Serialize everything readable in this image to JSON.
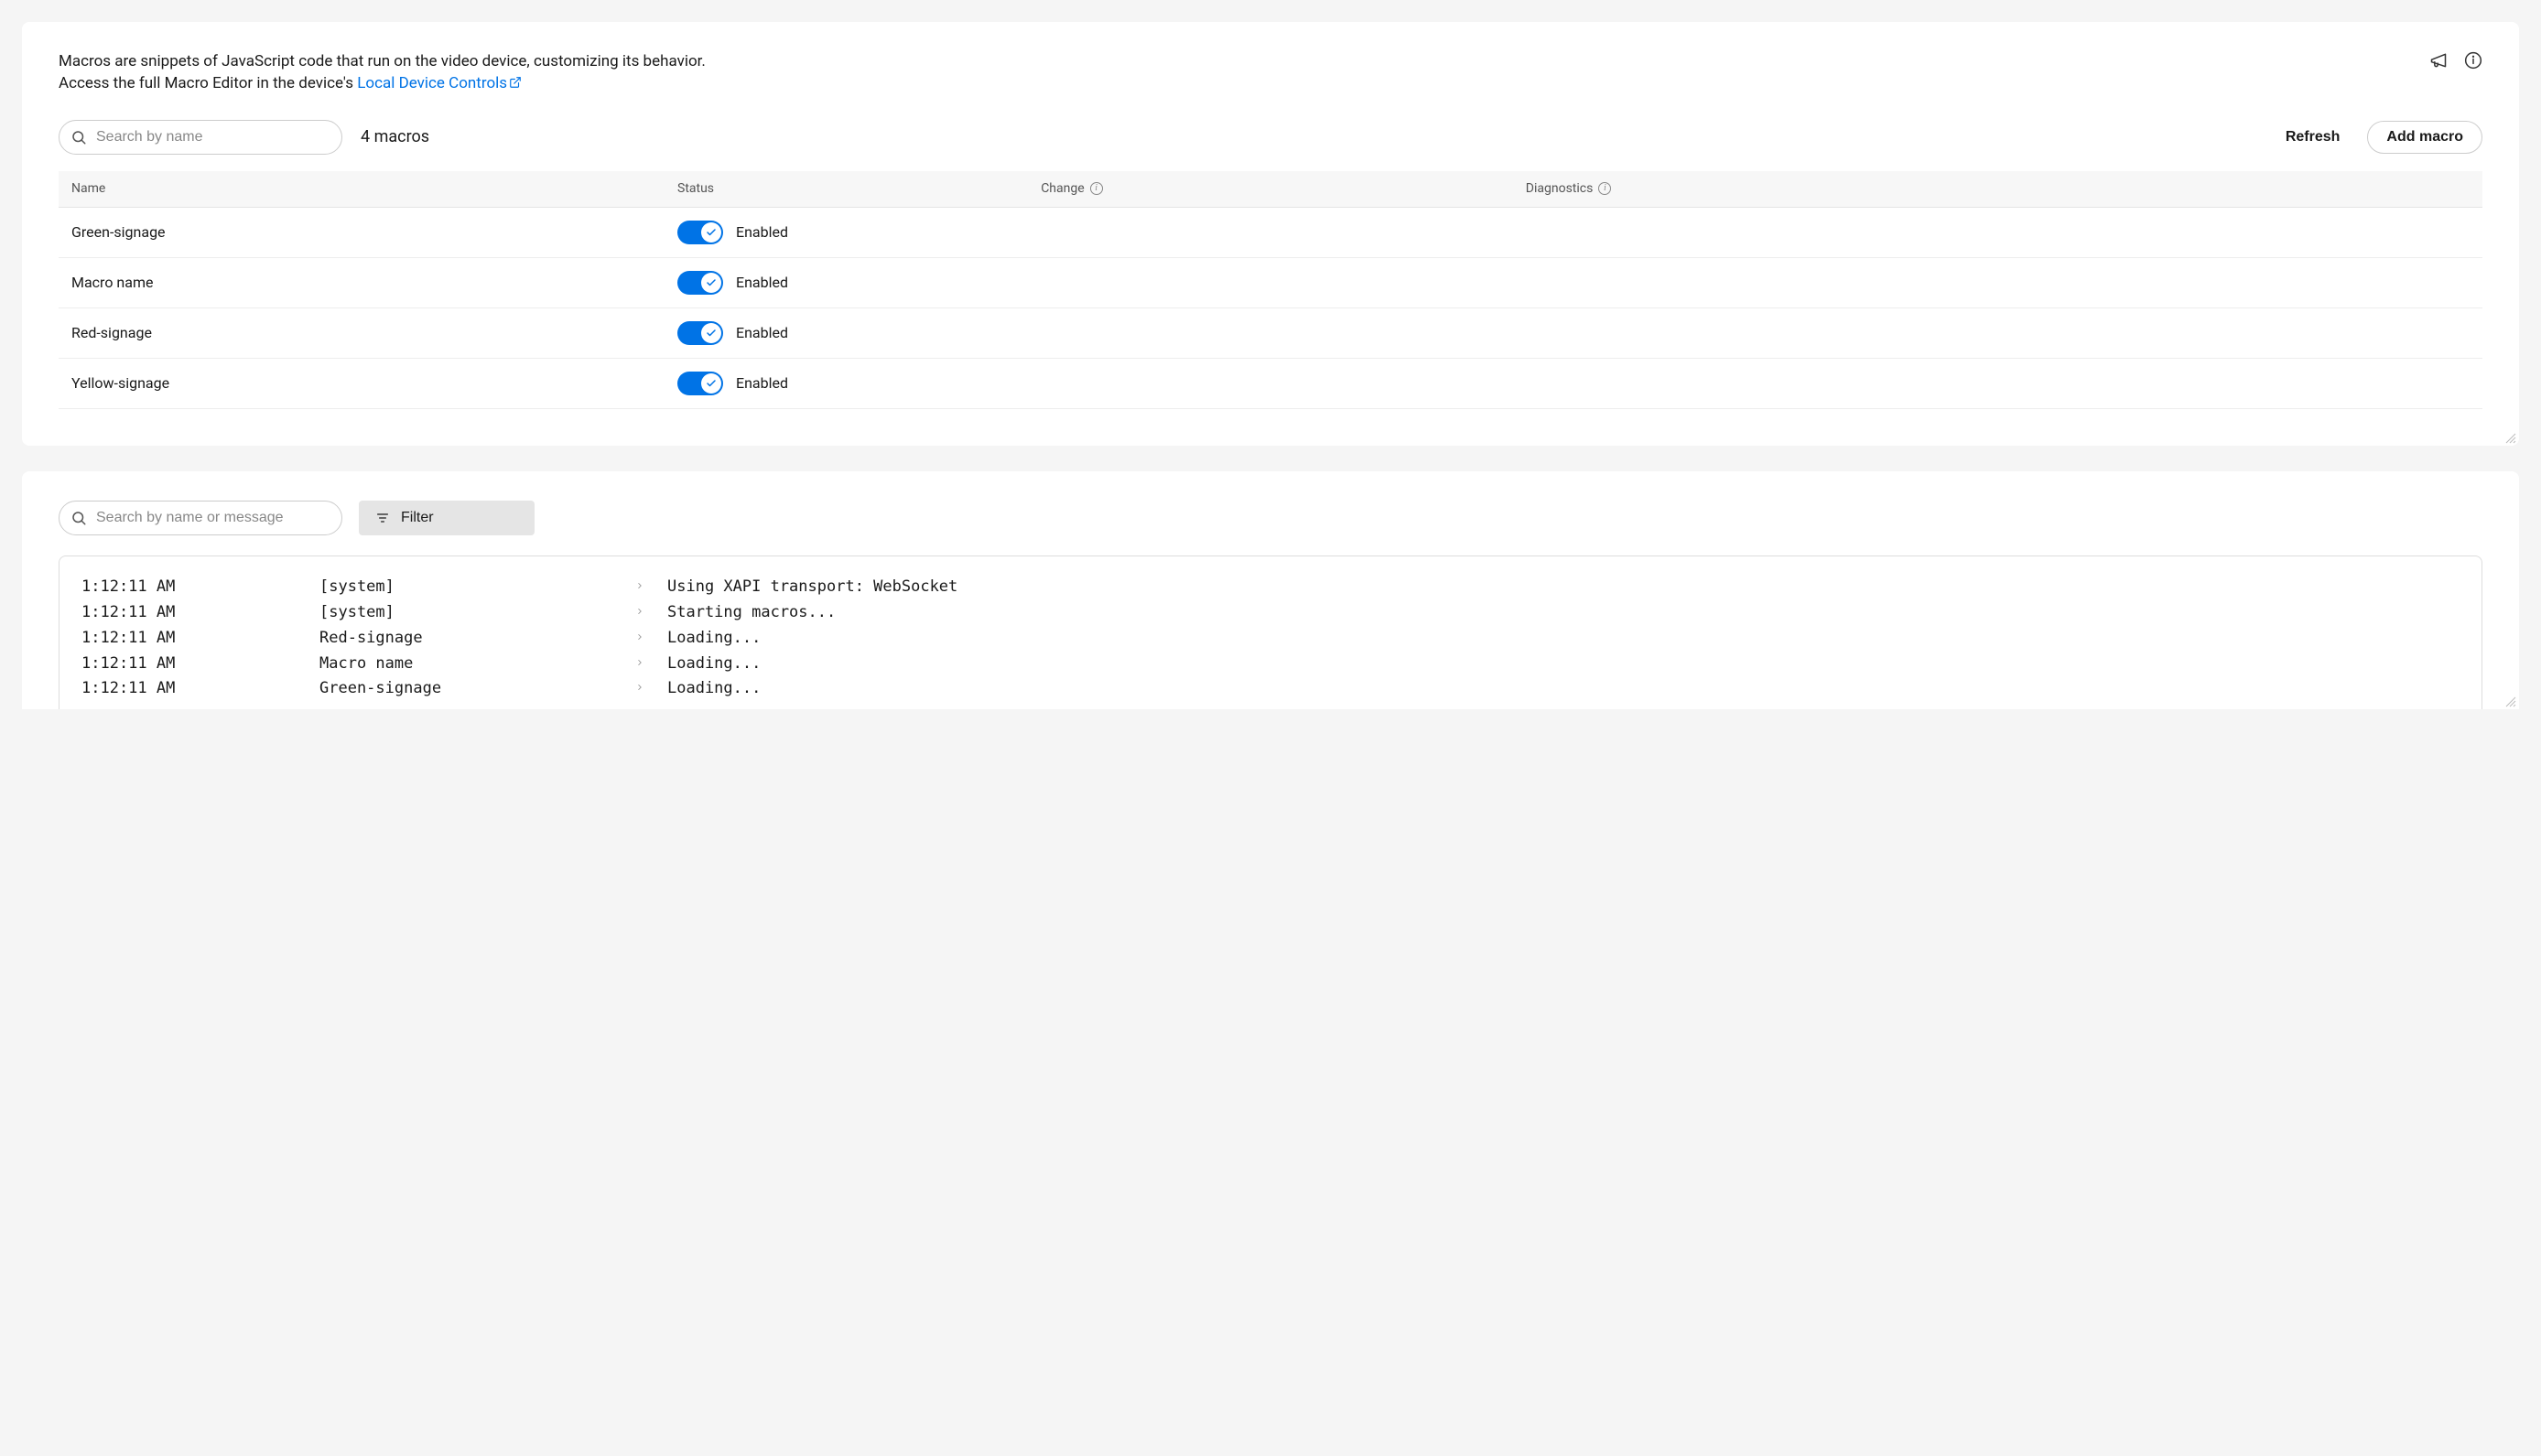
{
  "description_line1": "Macros are snippets of JavaScript code that run on the video device, customizing its behavior.",
  "description_line2_prefix": "Access the full Macro Editor in the device's ",
  "description_link": "Local Device Controls",
  "search_placeholder": "Search by name",
  "count_label": "4 macros",
  "refresh_label": "Refresh",
  "add_macro_label": "Add macro",
  "columns": {
    "name": "Name",
    "status": "Status",
    "change": "Change",
    "diagnostics": "Diagnostics"
  },
  "enabled_label": "Enabled",
  "macros": [
    {
      "name": "Green-signage"
    },
    {
      "name": "Macro name"
    },
    {
      "name": "Red-signage"
    },
    {
      "name": "Yellow-signage"
    }
  ],
  "log_search_placeholder": "Search by name or message",
  "filter_label": "Filter",
  "logs": [
    {
      "time": "1:12:11 AM",
      "source": "[system]",
      "msg": "Using XAPI transport: WebSocket"
    },
    {
      "time": "1:12:11 AM",
      "source": "[system]",
      "msg": "Starting macros..."
    },
    {
      "time": "1:12:11 AM",
      "source": "Red-signage",
      "msg": "Loading..."
    },
    {
      "time": "1:12:11 AM",
      "source": "Macro name",
      "msg": "Loading..."
    },
    {
      "time": "1:12:11 AM",
      "source": "Green-signage",
      "msg": "Loading..."
    }
  ]
}
